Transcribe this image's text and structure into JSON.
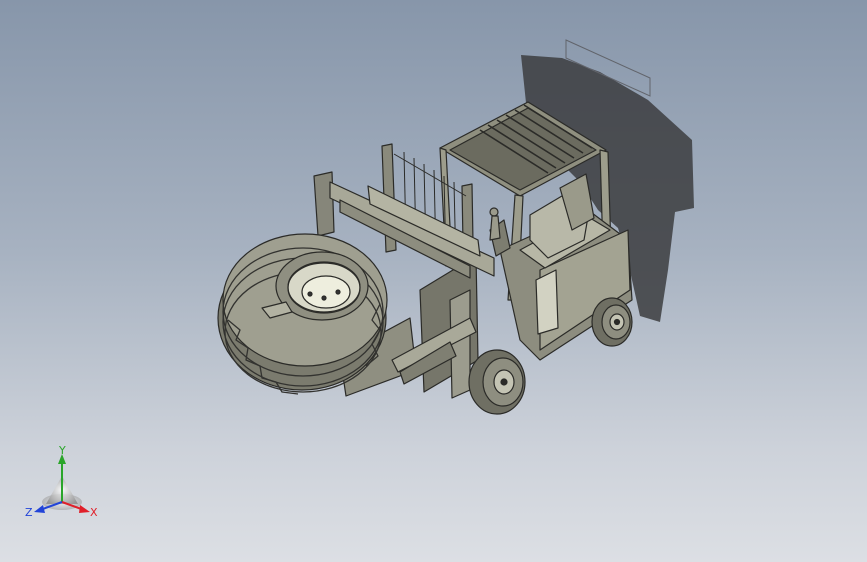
{
  "model": {
    "name": "forklift-with-tire-clamp"
  },
  "triad": {
    "x_label": "X",
    "y_label": "Y",
    "z_label": "Z",
    "colors": {
      "x": "#e0202a",
      "y": "#2aa52a",
      "z": "#2244d8"
    }
  }
}
